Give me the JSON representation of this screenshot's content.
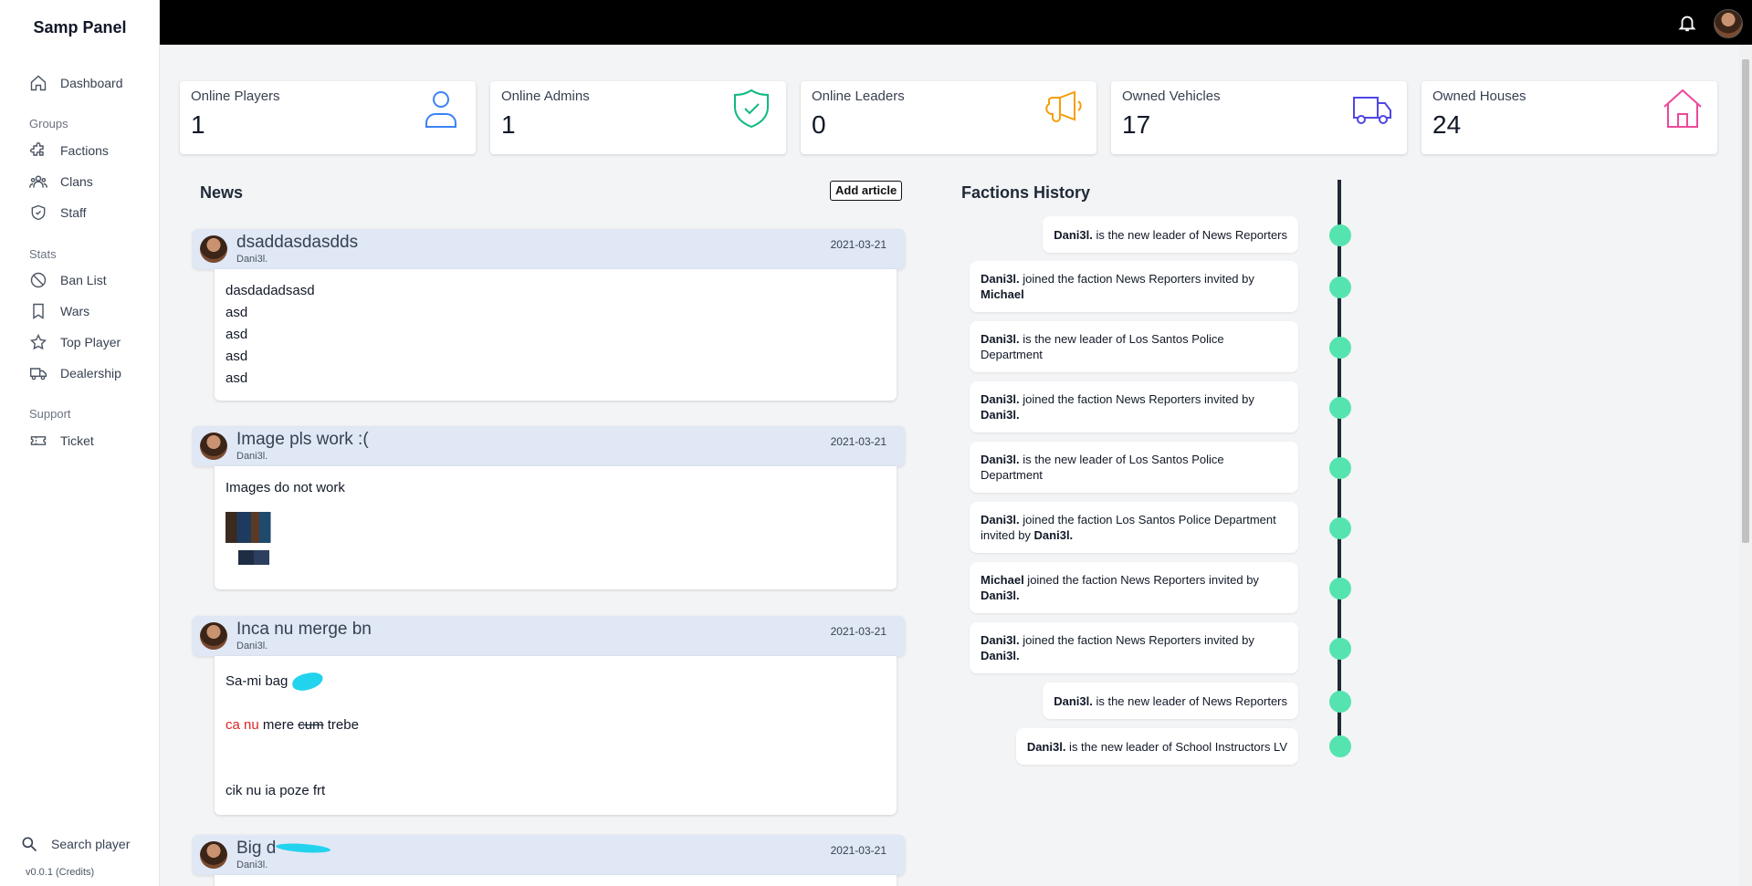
{
  "sidebar": {
    "brand": "Samp Panel",
    "dashboard": "Dashboard",
    "groups_label": "Groups",
    "factions": "Factions",
    "clans": "Clans",
    "staff": "Staff",
    "stats_label": "Stats",
    "ban_list": "Ban List",
    "wars": "Wars",
    "top_player": "Top Player",
    "dealership": "Dealership",
    "support_label": "Support",
    "ticket": "Ticket",
    "search_player": "Search player",
    "version": "v0.0.1 (Credits)"
  },
  "stats": [
    {
      "label": "Online Players",
      "value": "1",
      "icon": "user-icon",
      "color": "#3b82f6"
    },
    {
      "label": "Online Admins",
      "value": "1",
      "icon": "shield-check-icon",
      "color": "#10b981"
    },
    {
      "label": "Online Leaders",
      "value": "0",
      "icon": "megaphone-icon",
      "color": "#f59e0b"
    },
    {
      "label": "Owned Vehicles",
      "value": "17",
      "icon": "truck-icon",
      "color": "#4f46e5"
    },
    {
      "label": "Owned Houses",
      "value": "24",
      "icon": "home-icon",
      "color": "#ec4899"
    }
  ],
  "news": {
    "title": "News",
    "add_article": "Add article",
    "articles": [
      {
        "title": "dsaddasdasdds",
        "author": "Dani3l.",
        "date": "2021-03-21",
        "lines": [
          "dasdadadsasd",
          "asd",
          "asd",
          "asd",
          "asd"
        ]
      },
      {
        "title": "Image pls work :(",
        "author": "Dani3l.",
        "date": "2021-03-21",
        "text": "Images do not work"
      },
      {
        "title": "Inca nu merge bn",
        "author": "Dani3l.",
        "date": "2021-03-21",
        "line1": "Sa-mi bag",
        "red": "ca nu",
        "mid": "mere",
        "struck": "cum",
        "end": "trebe",
        "last": "cik nu ia poze frt"
      },
      {
        "title": "Big d",
        "author": "Dani3l.",
        "date": "2021-03-21"
      }
    ]
  },
  "history": {
    "title": "Factions History",
    "entries": [
      {
        "who": "Dani3l.",
        "text": " is the new leader of News Reporters",
        "by": ""
      },
      {
        "who": "Dani3l.",
        "text": " joined the faction News Reporters invited by ",
        "by": "Michael"
      },
      {
        "who": "Dani3l.",
        "text": " is the new leader of Los Santos Police Department",
        "by": ""
      },
      {
        "who": "Dani3l.",
        "text": " joined the faction News Reporters invited by ",
        "by": "Dani3l."
      },
      {
        "who": "Dani3l.",
        "text": " is the new leader of Los Santos Police Department",
        "by": ""
      },
      {
        "who": "Dani3l.",
        "text": " joined the faction Los Santos Police Department invited by ",
        "by": "Dani3l."
      },
      {
        "who": "Michael",
        "text": " joined the faction News Reporters invited by ",
        "by": "Dani3l."
      },
      {
        "who": "Dani3l.",
        "text": " joined the faction News Reporters invited by ",
        "by": "Dani3l."
      },
      {
        "who": "Dani3l.",
        "text": " is the new leader of News Reporters",
        "by": ""
      },
      {
        "who": "Dani3l.",
        "text": " is the new leader of School Instructors LV",
        "by": ""
      }
    ]
  }
}
